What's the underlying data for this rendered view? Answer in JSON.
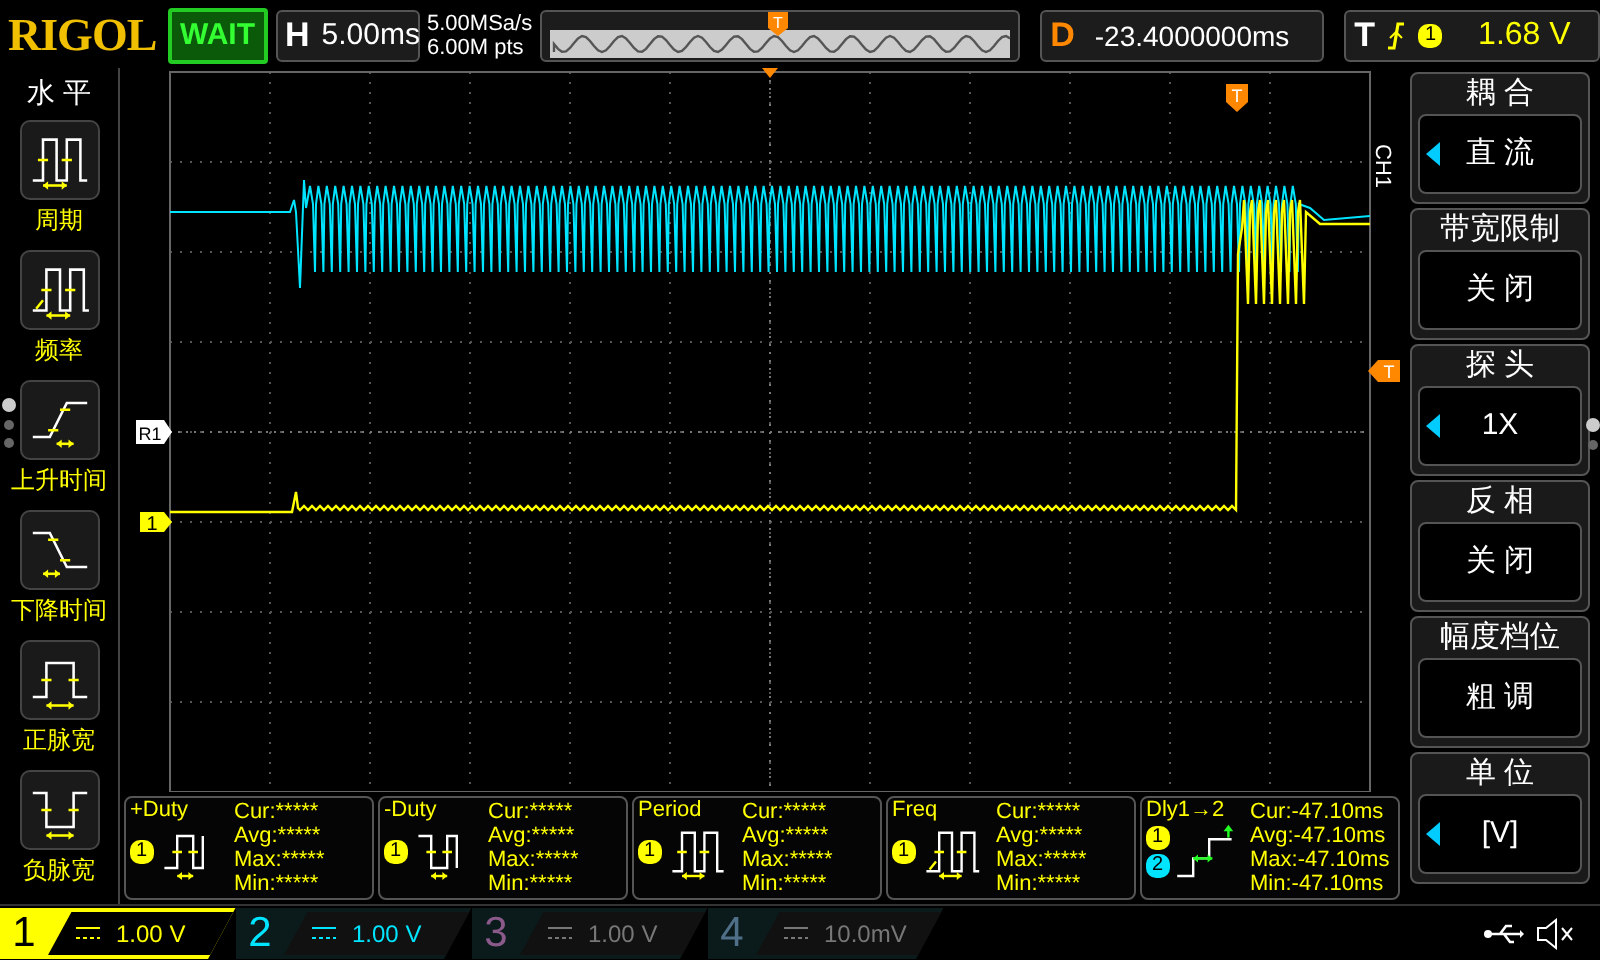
{
  "top_bar": {
    "logo": "RIGOL",
    "run_status": "WAIT",
    "timebase": {
      "label": "H",
      "value": "5.00ms"
    },
    "sample_rate": "5.00MSa/s",
    "memory_depth": "6.00M pts",
    "memory_marker": "T",
    "delay": {
      "label": "D",
      "value": "-23.4000000ms"
    },
    "trigger": {
      "label": "T",
      "source": "1",
      "level": "1.68 V"
    }
  },
  "left_menu": {
    "title": "水 平",
    "pages": [
      {
        "selected": true
      },
      {
        "selected": false
      },
      {
        "selected": false
      }
    ],
    "items": [
      {
        "label": "周期",
        "kind": "period"
      },
      {
        "label": "频率",
        "kind": "freq"
      },
      {
        "label": "上升时间",
        "kind": "rise"
      },
      {
        "label": "下降时间",
        "kind": "fall"
      },
      {
        "label": "正脉宽",
        "kind": "pos_width"
      },
      {
        "label": "负脉宽",
        "kind": "neg_width"
      }
    ]
  },
  "screen": {
    "reference_marker": "R1",
    "channel_marker": "1",
    "trigger_position_marker": "T",
    "trigger_level_marker": "T",
    "channel_label": "CH1"
  },
  "measurements": [
    {
      "name": "+Duty",
      "kind": "pos_duty",
      "sources": [
        {
          "label": "1",
          "color": "#ffff00"
        }
      ],
      "readings": [
        "Cur:*****",
        "Avg:*****",
        "Max:*****",
        "Min:*****"
      ]
    },
    {
      "name": "-Duty",
      "kind": "neg_duty",
      "sources": [
        {
          "label": "1",
          "color": "#ffff00"
        }
      ],
      "readings": [
        "Cur:*****",
        "Avg:*****",
        "Max:*****",
        "Min:*****"
      ]
    },
    {
      "name": "Period",
      "kind": "period",
      "sources": [
        {
          "label": "1",
          "color": "#ffff00"
        }
      ],
      "readings": [
        "Cur:*****",
        "Avg:*****",
        "Max:*****",
        "Min:*****"
      ]
    },
    {
      "name": "Freq",
      "kind": "freq",
      "sources": [
        {
          "label": "1",
          "color": "#ffff00"
        }
      ],
      "readings": [
        "Cur:*****",
        "Avg:*****",
        "Max:*****",
        "Min:*****"
      ]
    },
    {
      "name": "Dly1→2",
      "kind": "delay",
      "sources": [
        {
          "label": "1",
          "color": "#ffff00"
        },
        {
          "label": "2",
          "color": "#00e5ff"
        }
      ],
      "readings": [
        "Cur:-47.10ms",
        "Avg:-47.10ms",
        "Max:-47.10ms",
        "Min:-47.10ms"
      ]
    }
  ],
  "right_menu": {
    "pages": [
      {
        "selected": true
      },
      {
        "selected": false
      }
    ],
    "items": [
      {
        "title": "耦 合",
        "value": "直 流",
        "adjustable": true
      },
      {
        "title": "带宽限制",
        "value": "关 闭",
        "adjustable": false
      },
      {
        "title": "探 头",
        "value": "1X",
        "adjustable": true
      },
      {
        "title": "反 相",
        "value": "关 闭",
        "adjustable": false
      },
      {
        "title": "幅度档位",
        "value": "粗 调",
        "adjustable": false
      },
      {
        "title": "单 位",
        "value": "[V]",
        "adjustable": true
      }
    ]
  },
  "channels": [
    {
      "number": "1",
      "scale": "1.00 V",
      "color": "#ffff00",
      "selected": true,
      "enabled": true
    },
    {
      "number": "2",
      "scale": "1.00 V",
      "color": "#00e5ff",
      "selected": false,
      "enabled": true
    },
    {
      "number": "3",
      "scale": "1.00 V",
      "color": "#8a5a8a",
      "selected": false,
      "enabled": false
    },
    {
      "number": "4",
      "scale": "10.0mV",
      "color": "#50708a",
      "selected": false,
      "enabled": false
    }
  ]
}
